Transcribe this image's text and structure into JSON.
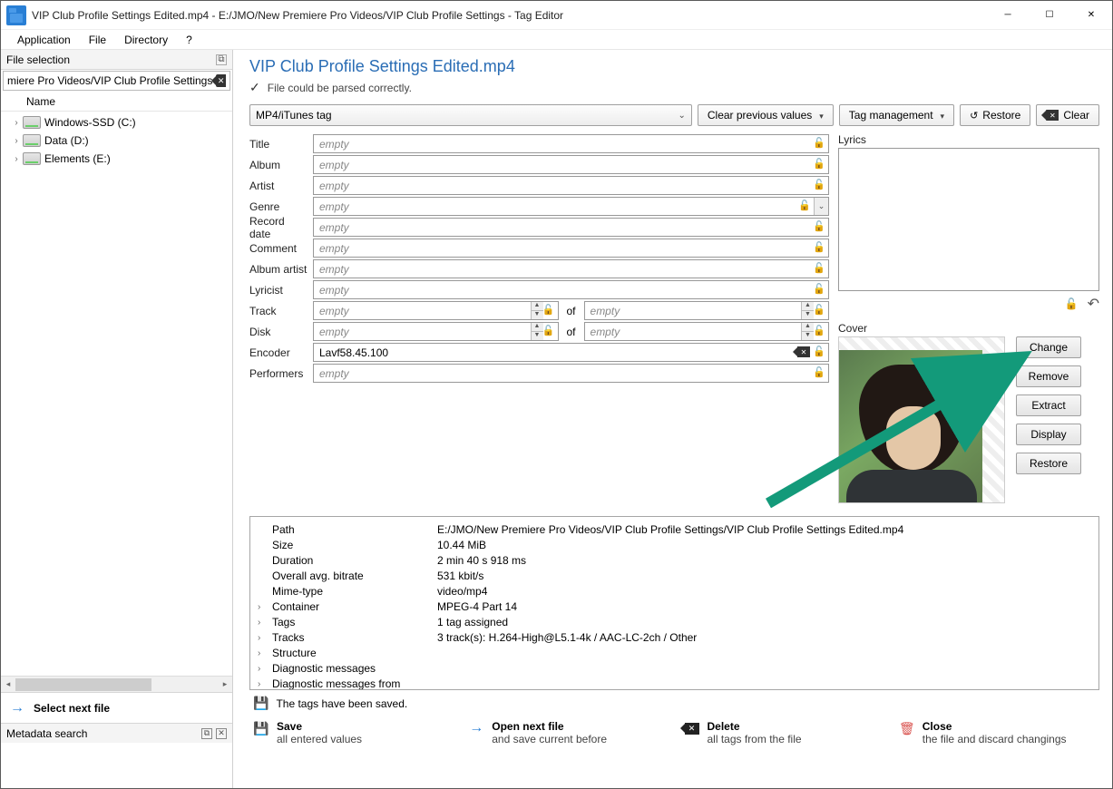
{
  "window": {
    "title": "VIP Club Profile Settings Edited.mp4 - E:/JMO/New Premiere Pro Videos/VIP Club Profile Settings - Tag Editor"
  },
  "menu": {
    "application": "Application",
    "file": "File",
    "directory": "Directory",
    "help": "?"
  },
  "left": {
    "file_selection": "File selection",
    "path_text": "miere Pro Videos/VIP Club Profile Settings",
    "name_header": "Name",
    "drives": [
      {
        "label": "Windows-SSD (C:)"
      },
      {
        "label": "Data (D:)"
      },
      {
        "label": "Elements (E:)"
      }
    ],
    "select_next": "Select next file",
    "metadata_search": "Metadata search"
  },
  "main": {
    "file_title": "VIP Club Profile Settings Edited.mp4",
    "parse_msg": "File could be parsed correctly.",
    "tag_format": "MP4/iTunes tag",
    "btn_clear_prev": "Clear previous values",
    "btn_tag_mgmt": "Tag management",
    "btn_restore": "Restore",
    "btn_clear": "Clear",
    "labels": {
      "title": "Title",
      "album": "Album",
      "artist": "Artist",
      "genre": "Genre",
      "record_date": "Record date",
      "comment": "Comment",
      "album_artist": "Album artist",
      "lyricist": "Lyricist",
      "track": "Track",
      "disk": "Disk",
      "encoder": "Encoder",
      "performers": "Performers",
      "of": "of"
    },
    "placeholders": {
      "empty": "empty"
    },
    "values": {
      "encoder": "Lavf58.45.100"
    },
    "lyrics_label": "Lyrics",
    "cover_label": "Cover",
    "cover_buttons": {
      "change": "Change",
      "remove": "Remove",
      "extract": "Extract",
      "display": "Display",
      "restore": "Restore"
    }
  },
  "info": {
    "rows": [
      {
        "exp": "",
        "k": "Path",
        "v": "E:/JMO/New Premiere Pro Videos/VIP Club Profile Settings/VIP Club Profile Settings Edited.mp4"
      },
      {
        "exp": "",
        "k": "Size",
        "v": "10.44 MiB"
      },
      {
        "exp": "",
        "k": "Duration",
        "v": "2 min 40 s 918 ms"
      },
      {
        "exp": "",
        "k": "Overall avg. bitrate",
        "v": "531 kbit/s"
      },
      {
        "exp": "",
        "k": "Mime-type",
        "v": "video/mp4"
      },
      {
        "exp": "›",
        "k": "Container",
        "v": "MPEG-4 Part 14"
      },
      {
        "exp": "›",
        "k": "Tags",
        "v": "1 tag assigned"
      },
      {
        "exp": "›",
        "k": "Tracks",
        "v": "3 track(s): H.264-High@L5.1-4k / AAC-LC-2ch / Other"
      },
      {
        "exp": "›",
        "k": "Structure",
        "v": ""
      },
      {
        "exp": "›",
        "k": "Diagnostic messages",
        "v": ""
      },
      {
        "exp": "›",
        "k": "Diagnostic messages from reparsing",
        "v": ""
      }
    ]
  },
  "status": {
    "saved": "The tags have been saved."
  },
  "actions": {
    "save": {
      "title": "Save",
      "sub": "all entered values"
    },
    "open": {
      "title": "Open next file",
      "sub": "and save current before"
    },
    "delete": {
      "title": "Delete",
      "sub": "all tags from the file"
    },
    "close": {
      "title": "Close",
      "sub": "the file and discard changings"
    }
  }
}
